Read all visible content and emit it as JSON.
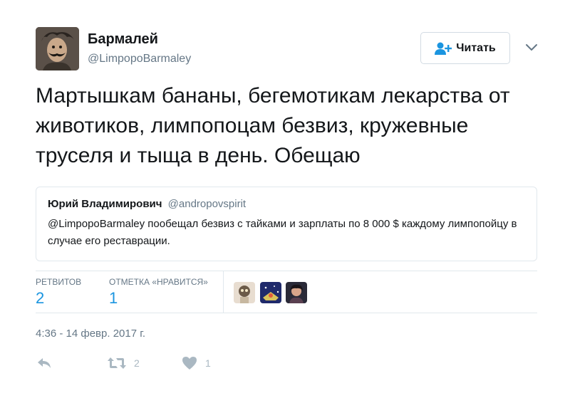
{
  "author": {
    "name": "Бармалей",
    "handle": "@LimpopoBarmaley",
    "avatar_icon": "user-avatar-icon"
  },
  "follow_button": {
    "label": "Читать",
    "icon": "add-user-icon"
  },
  "tweet": {
    "text": "Мартышкам бананы, бегемотикам лекарства от животиков, лимпопоцам безвиз, кружевные труселя и тыща в день. Обещаю"
  },
  "quoted_tweet": {
    "name": "Юрий Владимирович",
    "handle": "@andropovspirit",
    "text": "@LimpopoBarmaley пообещал безвиз с тайками и зарплаты по 8 000 $ каждому лимпопойцу в случае его реставрации."
  },
  "stats": {
    "retweets_label": "РЕТВИТОВ",
    "retweets_count": "2",
    "likes_label": "ОТМЕТКА «НРАВИТСЯ»",
    "likes_count": "1"
  },
  "timestamp": "4:36 - 14 февр. 2017 г.",
  "actions": {
    "reply_icon": "reply-icon",
    "retweet_icon": "retweet-icon",
    "retweet_count": "2",
    "like_icon": "heart-icon",
    "like_count": "1"
  },
  "colors": {
    "accent": "#1b95e0",
    "muted": "#657786",
    "border": "#e1e8ed",
    "icon": "#aab8c2"
  }
}
